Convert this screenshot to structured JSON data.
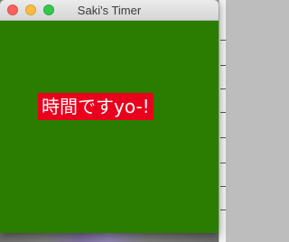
{
  "window": {
    "title": "Saki's Timer",
    "background_color": "#2a7d00"
  },
  "titlebar": {
    "close_icon": "close-icon",
    "minimize_icon": "minimize-icon",
    "maximize_icon": "maximize-icon"
  },
  "timer": {
    "message": "時間ですyo-!",
    "message_background": "#e8001c",
    "message_color": "#ffffff"
  }
}
